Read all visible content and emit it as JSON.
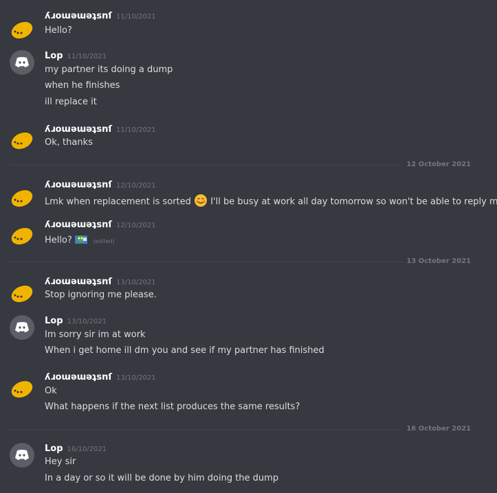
{
  "users": {
    "ju": "ʎɹoɯǝɯǝʇsnſ",
    "lop": "Lop"
  },
  "messages": [
    {
      "ts": "11/10/2021",
      "lines": [
        "Hello?"
      ]
    },
    {
      "ts": "11/10/2021",
      "lines": [
        "my partner its doing a dump",
        "when he finishes",
        "ill replace it"
      ]
    },
    {
      "ts": "11/10/2021",
      "lines": [
        "Ok, thanks"
      ]
    },
    {
      "ts": "12/10/2021",
      "lines": [
        "Lmk when replacement is sorted",
        "I'll be busy at work all day tomorrow so won't be able to reply much"
      ]
    },
    {
      "ts": "12/10/2021",
      "lines": [
        "Hello?"
      ],
      "edited": "(edited)"
    },
    {
      "ts": "13/10/2021",
      "lines": [
        "Stop ignoring me please."
      ]
    },
    {
      "ts": "13/10/2021",
      "lines": [
        "Im sorry sir im at work",
        "When i get home ill dm you and see if my partner has finished"
      ]
    },
    {
      "ts": "13/10/2021",
      "lines": [
        "Ok",
        "What happens if the next list produces the same results?"
      ]
    },
    {
      "ts": "16/10/2021",
      "lines": [
        "Hey sir",
        "In a day or so it will be done by him doing the dump"
      ]
    }
  ],
  "dividers": [
    "12 October 2021",
    "13 October 2021",
    "16 October 2021"
  ],
  "icons": {
    "discord_avatar": "discord-logo-icon",
    "ju_avatar": "yellow-blob-avatar-icon"
  }
}
